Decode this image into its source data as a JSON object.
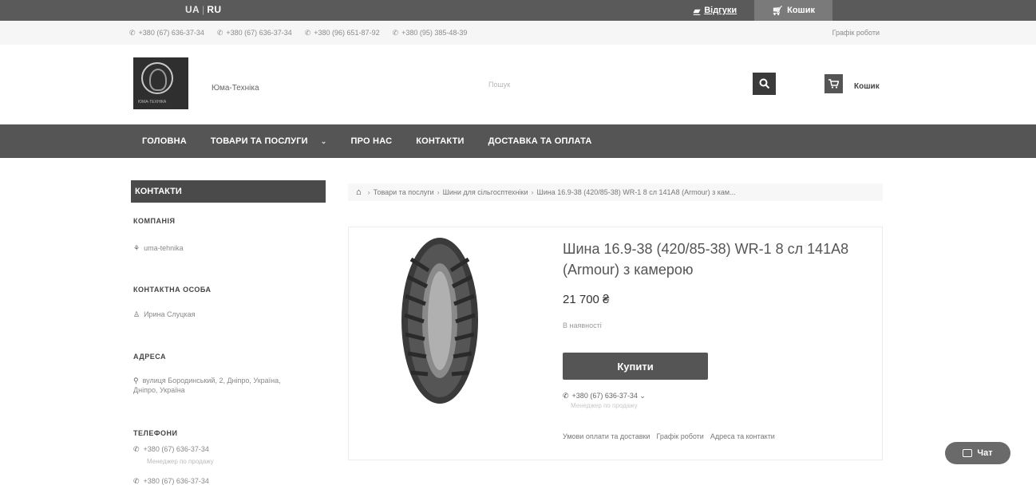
{
  "top_bar": {
    "lang_ua": "UA",
    "lang_sep": "|",
    "lang_ru": "RU",
    "reviews_label": "Відгуки",
    "cart_label": "Кошик"
  },
  "contacts_strip": {
    "phones": [
      "+380 (67) 636-37-34",
      "+380 (67) 636-37-34",
      "+380 (96) 651-87-92",
      "+380 (95) 385-48-39"
    ],
    "schedule_label": "Графік роботи"
  },
  "header": {
    "logo_text": "ЮМА-ТЕХНІКА",
    "company_name": "Юма-Техніка",
    "search_placeholder": "Пошук",
    "cart_label": "Кошик"
  },
  "nav": {
    "items": [
      {
        "label": "ГОЛОВНА"
      },
      {
        "label": "ТОВАРИ ТА ПОСЛУГИ"
      },
      {
        "label": "ПРО НАС"
      },
      {
        "label": "КОНТАКТИ"
      },
      {
        "label": "ДОСТАВКА ТА ОПЛАТА"
      }
    ]
  },
  "sidebar": {
    "title": "КОНТАКТИ",
    "company_heading": "КОМПАНІЯ",
    "company_value": "uma-tehnika",
    "person_heading": "КОНТАКТНА ОСОБА",
    "person_value": "Ирина Слуцкая",
    "address_heading": "АДРЕСА",
    "address_line1": "вулиця Бородинський, 2, Дніпро, Україна,",
    "address_line2": "Дніпро, Україна",
    "phones_heading": "ТЕЛЕФОНИ",
    "phone1": "+380 (67) 636-37-34",
    "phone1_note": "Менеджер по продажу",
    "phone2": "+380 (67) 636-37-34"
  },
  "breadcrumb": {
    "items": [
      "Товари та послуги",
      "Шини для сільгосптехніки",
      "Шина 16.9-38 (420/85-38) WR-1 8 сл 141А8 (Armour) з кам..."
    ]
  },
  "product": {
    "title": "Шина 16.9-38 (420/85-38) WR-1 8 сл 141A8 (Armour) з камерою",
    "price": "21 700 ₴",
    "stock": "В наявності",
    "buy_label": "Купити",
    "phone": "+380 (67) 636-37-34",
    "phone_note": "Менеджер по продажу",
    "links": [
      "Умови оплати та доставки",
      "Графік роботи",
      "Адреса та контакти"
    ]
  },
  "chat": {
    "label": "Чат"
  },
  "colors": {
    "top_bar": "#5a5a5a",
    "nav_bar": "#555555",
    "button": "#555555"
  }
}
